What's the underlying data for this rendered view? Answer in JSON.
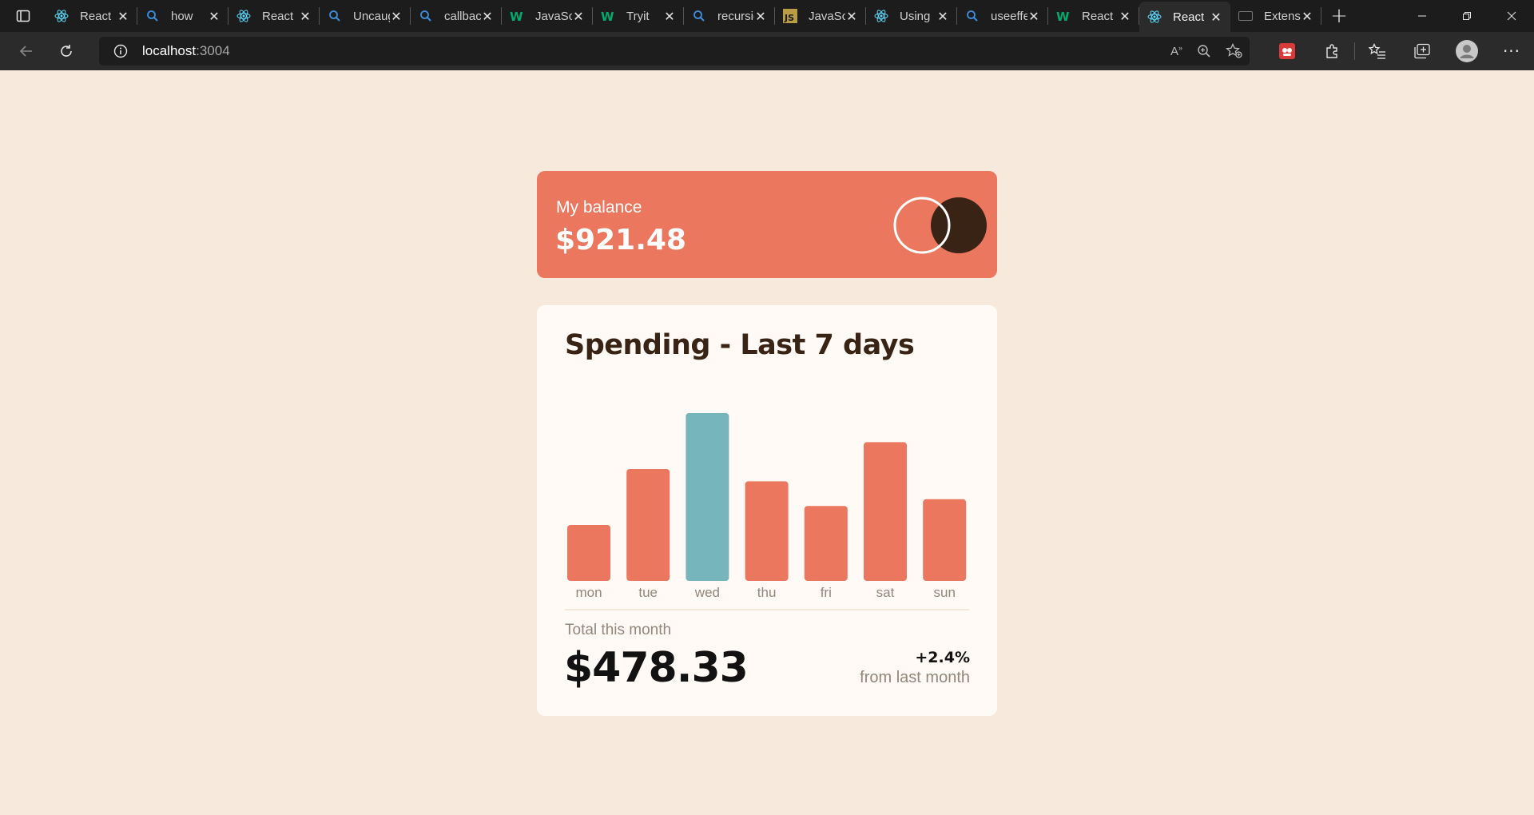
{
  "browser": {
    "tabs": [
      {
        "label": "React",
        "icon": "react-icon",
        "active": false
      },
      {
        "label": "how",
        "icon": "search-icon",
        "active": false
      },
      {
        "label": "React",
        "icon": "react-icon",
        "active": false
      },
      {
        "label": "Uncaught",
        "icon": "search-icon",
        "active": false
      },
      {
        "label": "callback",
        "icon": "search-icon",
        "active": false
      },
      {
        "label": "JavaScript",
        "icon": "w3schools-icon",
        "active": false
      },
      {
        "label": "Tryit",
        "icon": "w3schools-icon",
        "active": false
      },
      {
        "label": "recursion",
        "icon": "search-icon",
        "active": false
      },
      {
        "label": "JavaScript",
        "icon": "js-icon",
        "active": false
      },
      {
        "label": "Using",
        "icon": "react-icon",
        "active": false
      },
      {
        "label": "useeffect",
        "icon": "search-icon",
        "active": false
      },
      {
        "label": "React",
        "icon": "w3schools-icon",
        "active": false
      },
      {
        "label": "React",
        "icon": "react-icon",
        "active": true
      },
      {
        "label": "Extensions",
        "icon": "extension-page-icon",
        "active": false
      }
    ],
    "url_host": "localhost",
    "url_port": ":3004"
  },
  "balance_card": {
    "label": "My balance",
    "amount": "$921.48"
  },
  "spending_card": {
    "title": "Spending - Last 7 days",
    "total_label": "Total this month",
    "total_amount": "$478.33",
    "change_percent": "+2.4%",
    "change_label": "from last month"
  },
  "colors": {
    "bar": "#ec775f",
    "bar_highlight": "#76b5bc",
    "balance_bg": "#ec775f",
    "page_bg": "#f8e9dd",
    "card_bg": "#fffaf5",
    "dark_brown": "#382314"
  },
  "chart_data": {
    "type": "bar",
    "categories": [
      "mon",
      "tue",
      "wed",
      "thu",
      "fri",
      "sat",
      "sun"
    ],
    "values": [
      17.45,
      34.91,
      52.36,
      31.07,
      23.39,
      43.28,
      25.48
    ],
    "highlight_index": 2,
    "title": "",
    "xlabel": "",
    "ylabel": "",
    "grid": false
  }
}
